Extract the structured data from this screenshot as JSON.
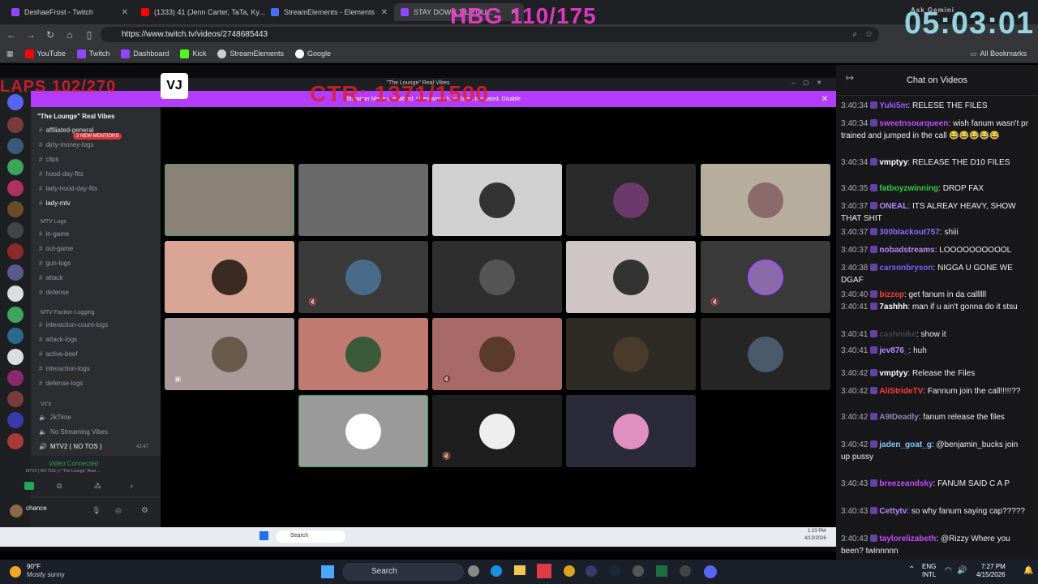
{
  "tabs": [
    "DeshaeFrost - Twitch",
    "(1333) 41 (Jenn Carter, TaTa, Ky...",
    "StreamElements - Elements",
    "STAY DOWN TIL YOU..."
  ],
  "url": "https://www.twitch.tv/videos/2748685443",
  "bookmarks": [
    "YouTube",
    "Twitch",
    "Dashboard",
    "Kick",
    "StreamElements",
    "Google"
  ],
  "all_bookmarks": "All Bookmarks",
  "overlay": {
    "hbg": "HBG 110/175",
    "timer": "05:03:01",
    "laps": "LAPS 102/270",
    "ctr": "CTR: 1371/1500",
    "gemini": "Ask Gemini"
  },
  "discord": {
    "window_title": "\"The Lounge\" Real Vibes",
    "banner": "Streamer Mode is enabled. Usernames have been truncated. Disable",
    "server_name": "\"The Lounge\" Real Vibes",
    "mentions": "2 NEW MENTIONS",
    "channels_top": [
      "affiliated-general",
      "dirty-money-logs",
      "clips",
      "hood-day-fits",
      "lady-hood-day-fits",
      "lady-mtv"
    ],
    "cat1": "MTV Logs",
    "channels_mid": [
      "in-game",
      "out-game",
      "gun-logs",
      "attack",
      "defense"
    ],
    "cat2": "MTV Faction Logging",
    "channels_low": [
      "interaction-count-logs",
      "attack-logs",
      "active-beef",
      "interaction-logs",
      "defense-logs"
    ],
    "cat3": "Vc's",
    "voice": [
      "2kTime",
      "No Streaming Vibes",
      "MTV2 ( NO TOS )"
    ],
    "voice_time": "42:47",
    "video_connected": "Video Connected",
    "vc_sub": "MTV2 ( NO TOS ) / \"The Lounge\" Real ...",
    "user": "chance",
    "search": "Search",
    "clock_time": "1:23 PM",
    "clock_date": "4/13/2026"
  },
  "chat": {
    "title": "Chat on Videos",
    "messages": [
      {
        "ts": "3:40:34",
        "user": "Yuki5m",
        "color": "#9b59ff",
        "text": "RELESE THE FILES"
      },
      {
        "ts": "3:40:34",
        "user": "sweetnsourqueen",
        "color": "#c34bff",
        "text": "wish fanum wasn't pr trained and jumped in the call 😂😂😂😂😂"
      },
      {
        "ts": "3:40:34",
        "user": "vmptyy",
        "color": "#ffffff",
        "text": "RELEASE THE D10 FILES"
      },
      {
        "ts": "3:40:35",
        "user": "fatboyzwinning",
        "color": "#2ecc40",
        "text": "DROP FAX"
      },
      {
        "ts": "3:40:37",
        "user": "ONEAL",
        "color": "#b58aff",
        "text": "ITS ALREAY HEAVY, SHOW THAT SHIT"
      },
      {
        "ts": "3:40:37",
        "user": "300blackout757",
        "color": "#8a6cff",
        "text": "shiii"
      },
      {
        "ts": "3:40:37",
        "user": "nobadstreams",
        "color": "#b58aff",
        "text": "LOOOOOOOOOOL"
      },
      {
        "ts": "3:40:38",
        "user": "carsonbryson",
        "color": "#7d5cff",
        "text": "NIGGA U GONE WE DGAF"
      },
      {
        "ts": "3:40:40",
        "user": "bizzep",
        "color": "#ff3b3b",
        "text": "get fanum in da callllll"
      },
      {
        "ts": "3:40:41",
        "user": "7ashhh",
        "color": "#ffffff",
        "text": "man if u ain't gonna do it stsu"
      },
      {
        "ts": "3:40:41",
        "user": "cashmike",
        "color": "#444444",
        "text": "show it"
      },
      {
        "ts": "3:40:41",
        "user": "jev876_",
        "color": "#b58aff",
        "text": "huh"
      },
      {
        "ts": "3:40:42",
        "user": "vmptyy",
        "color": "#ffffff",
        "text": "Release the Files"
      },
      {
        "ts": "3:40:42",
        "user": "AliStrideTV",
        "color": "#ff3b3b",
        "text": "Fannum join the call!!!!!??"
      },
      {
        "ts": "3:40:42",
        "user": "A9IDeadly",
        "color": "#8a8ab8",
        "text": "fanum release the files"
      },
      {
        "ts": "3:40:42",
        "user": "jaden_goat_g",
        "color": "#7dc8ff",
        "text": "@benjamin_bucks join up pussy"
      },
      {
        "ts": "3:40:43",
        "user": "breezeandsky",
        "color": "#c34bff",
        "text": "FANUM SAID C A P"
      },
      {
        "ts": "3:40:43",
        "user": "Cettytv",
        "color": "#b58aff",
        "text": "so why fanum saying cap?????"
      },
      {
        "ts": "3:40:43",
        "user": "taylorelizabeth",
        "color": "#c34bff",
        "text": "@Rizzy Where you been? twinnnnn"
      }
    ]
  },
  "weather": {
    "temp": "90°F",
    "desc": "Mostly sunny"
  },
  "taskbar": {
    "search": "Search",
    "lang1": "ENG",
    "lang2": "INTL",
    "time": "7:27 PM",
    "date": "4/15/2026"
  }
}
